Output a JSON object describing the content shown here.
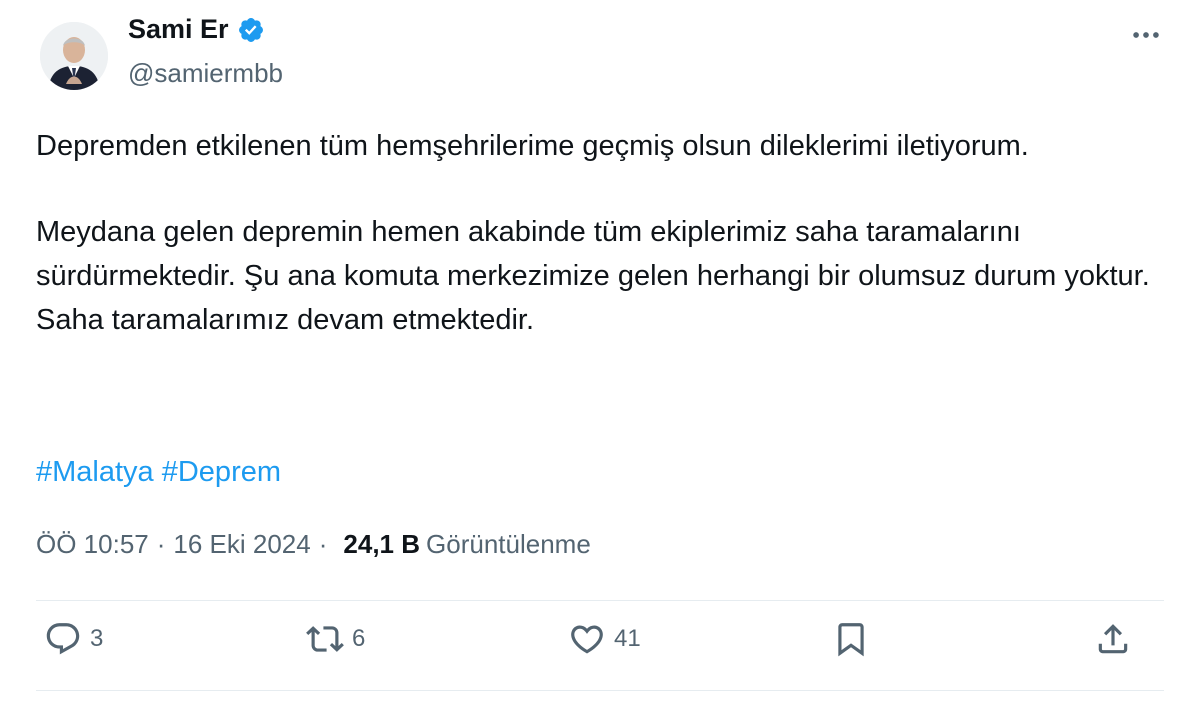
{
  "author": {
    "name": "Sami Er",
    "handle": "@samiermbb",
    "verified": true,
    "avatar_icon": "profile-photo",
    "accent": "#1d9bf0"
  },
  "tweet": {
    "paragraph1": "Depremden etkilenen tüm hemşehrilerime geçmiş olsun dileklerimi iletiyorum.",
    "paragraph2": "Meydana gelen depremin hemen akabinde tüm ekiplerimiz saha taramalarını sürdürmektedir. Şu ana komuta merkezimize gelen herhangi bir olumsuz durum yoktur. Saha taramalarımız devam etmektedir.",
    "hashtags": [
      "#Malatya",
      "#Deprem"
    ]
  },
  "meta": {
    "time": "ÖÖ 10:57",
    "separator": "·",
    "date": "16 Eki 2024",
    "views_count": "24,1 B",
    "views_label": "Görüntülenme"
  },
  "actions": {
    "replies": "3",
    "retweets": "6",
    "likes": "41",
    "icons": [
      "reply-icon",
      "retweet-icon",
      "like-icon",
      "bookmark-icon",
      "share-icon"
    ]
  }
}
